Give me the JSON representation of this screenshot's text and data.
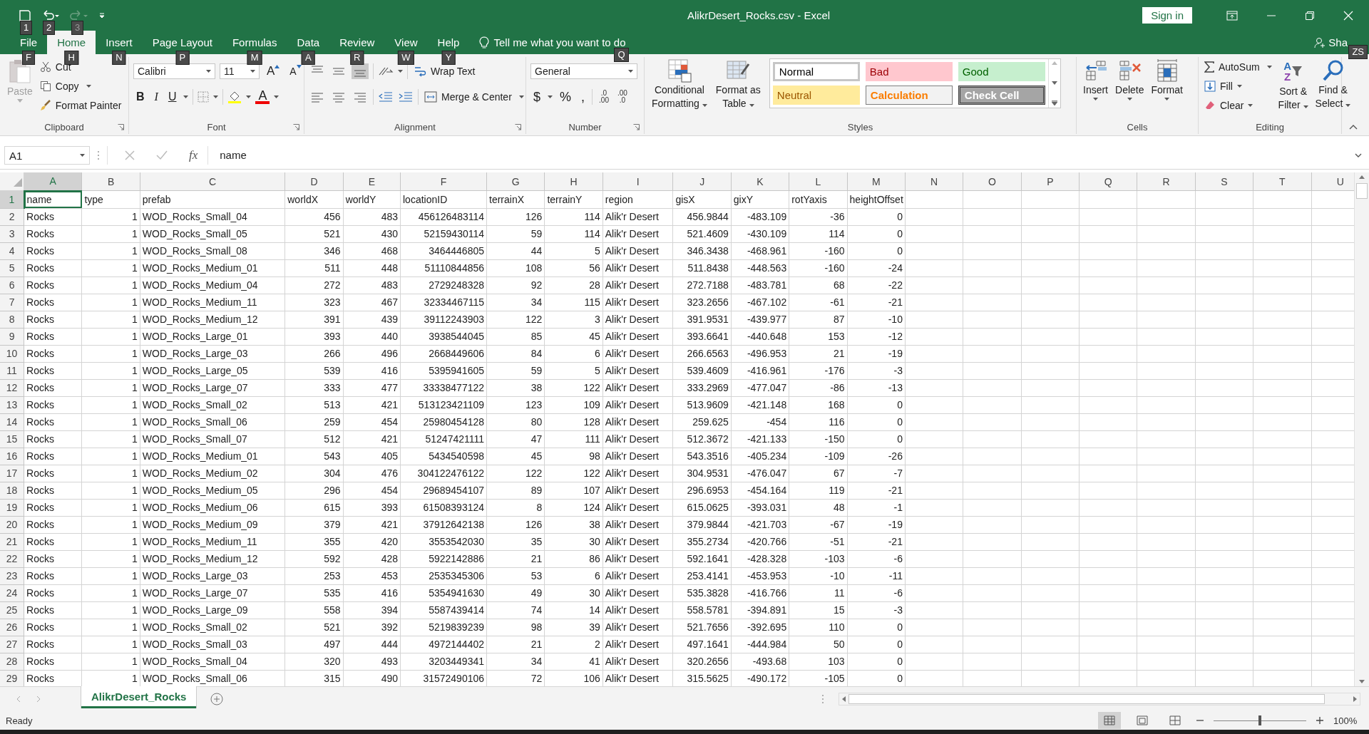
{
  "title_bar": {
    "title": "AlikrDesert_Rocks.csv  -  Excel",
    "sign_in": "Sign in",
    "quick_access_keytips": [
      "1",
      "2",
      "3"
    ]
  },
  "menu_tabs": [
    {
      "label": "File",
      "keytip": "F",
      "selected": false
    },
    {
      "label": "Home",
      "keytip": "H",
      "selected": true
    },
    {
      "label": "Insert",
      "keytip": "N",
      "selected": false
    },
    {
      "label": "Page Layout",
      "keytip": "P",
      "selected": false
    },
    {
      "label": "Formulas",
      "keytip": "M",
      "selected": false
    },
    {
      "label": "Data",
      "keytip": "A",
      "selected": false
    },
    {
      "label": "Review",
      "keytip": "R",
      "selected": false
    },
    {
      "label": "View",
      "keytip": "W",
      "selected": false
    },
    {
      "label": "Help",
      "keytip": "Y",
      "selected": false
    }
  ],
  "tell_me": {
    "placeholder": "Tell me what you want to do",
    "keytip": "Q"
  },
  "share": {
    "label": "Sha",
    "keytip": "ZS"
  },
  "ribbon": {
    "clipboard": {
      "label": "Clipboard",
      "paste": {
        "label": "Paste",
        "disabled": true
      },
      "cut": "Cut",
      "copy": "Copy",
      "format_painter": "Format Painter"
    },
    "font": {
      "label": "Font",
      "font_name": "Calibri",
      "font_size": "11",
      "grow": "A",
      "shrink": "A",
      "bold": "B",
      "italic": "I",
      "underline": "U",
      "font_color": "A"
    },
    "alignment": {
      "label": "Alignment",
      "wrap_text": "Wrap Text",
      "merge": "Merge & Center"
    },
    "number": {
      "label": "Number",
      "format": "General",
      "currency": "$",
      "percent": "%",
      "comma": ",",
      "decimals": [
        {
          "top": ".0",
          "bottom": ".00"
        },
        {
          "top": ".00",
          "bottom": ".0"
        }
      ]
    },
    "styles": {
      "label": "Styles",
      "conditional": [
        "Conditional",
        "Formatting"
      ],
      "format_table": [
        "Format as",
        "Table"
      ],
      "gallery": [
        {
          "label": "Normal",
          "kind": "normal",
          "selected": true
        },
        {
          "label": "Bad",
          "kind": "bad",
          "selected": false
        },
        {
          "label": "Good",
          "kind": "good",
          "selected": false
        },
        {
          "label": "Neutral",
          "kind": "neutral",
          "selected": false
        },
        {
          "label": "Calculation",
          "kind": "calculation",
          "selected": false
        },
        {
          "label": "Check Cell",
          "kind": "check",
          "selected": false
        }
      ]
    },
    "cells": {
      "label": "Cells",
      "buttons": [
        {
          "label": "Insert",
          "kind": "insert"
        },
        {
          "label": "Delete",
          "kind": "delete"
        },
        {
          "label": "Format",
          "kind": "format"
        }
      ]
    },
    "editing": {
      "label": "Editing",
      "autosum": "AutoSum",
      "fill": "Fill",
      "clear": "Clear",
      "sort": [
        "Sort &",
        "Filter"
      ],
      "sort_letters": [
        "A",
        "Z"
      ],
      "find": [
        "Find &",
        "Select"
      ]
    }
  },
  "formula_bar": {
    "name_box": "A1",
    "fx": "fx",
    "value": "name"
  },
  "columns": [
    {
      "letter": "A",
      "kind": "text",
      "selected": true
    },
    {
      "letter": "B",
      "kind": "number",
      "selected": false
    },
    {
      "letter": "C",
      "kind": "text",
      "selected": false
    },
    {
      "letter": "D",
      "kind": "number",
      "selected": false
    },
    {
      "letter": "E",
      "kind": "number",
      "selected": false
    },
    {
      "letter": "F",
      "kind": "number",
      "selected": false
    },
    {
      "letter": "G",
      "kind": "number",
      "selected": false
    },
    {
      "letter": "H",
      "kind": "number",
      "selected": false
    },
    {
      "letter": "I",
      "kind": "text",
      "selected": false
    },
    {
      "letter": "J",
      "kind": "number",
      "selected": false
    },
    {
      "letter": "K",
      "kind": "number",
      "selected": false
    },
    {
      "letter": "L",
      "kind": "number",
      "selected": false
    },
    {
      "letter": "M",
      "kind": "number",
      "selected": false
    },
    {
      "letter": "N",
      "selected": false
    },
    {
      "letter": "O",
      "selected": false
    },
    {
      "letter": "P",
      "selected": false
    },
    {
      "letter": "Q",
      "selected": false
    },
    {
      "letter": "R",
      "selected": false
    },
    {
      "letter": "S",
      "selected": false
    },
    {
      "letter": "T",
      "selected": false
    },
    {
      "letter": "U",
      "selected": false
    }
  ],
  "rows": [
    {
      "number": "1",
      "selected": true,
      "kind": "heading",
      "cells": [
        "name",
        "type",
        "prefab",
        "worldX",
        "worldY",
        "locationID",
        "terrainX",
        "terrainY",
        "region",
        "gisX",
        "gixY",
        "rotYaxis",
        "heightOffset"
      ]
    },
    {
      "number": "2",
      "selected": false,
      "cells": [
        "Rocks",
        "1",
        "WOD_Rocks_Small_04",
        "456",
        "483",
        "456126483114",
        "126",
        "114",
        "Alik'r Desert",
        "456.9844",
        "-483.109",
        "-36",
        "0"
      ]
    },
    {
      "number": "3",
      "selected": false,
      "cells": [
        "Rocks",
        "1",
        "WOD_Rocks_Small_05",
        "521",
        "430",
        "52159430114",
        "59",
        "114",
        "Alik'r Desert",
        "521.4609",
        "-430.109",
        "114",
        "0"
      ]
    },
    {
      "number": "4",
      "selected": false,
      "cells": [
        "Rocks",
        "1",
        "WOD_Rocks_Small_08",
        "346",
        "468",
        "3464446805",
        "44",
        "5",
        "Alik'r Desert",
        "346.3438",
        "-468.961",
        "-160",
        "0"
      ]
    },
    {
      "number": "5",
      "selected": false,
      "cells": [
        "Rocks",
        "1",
        "WOD_Rocks_Medium_01",
        "511",
        "448",
        "51110844856",
        "108",
        "56",
        "Alik'r Desert",
        "511.8438",
        "-448.563",
        "-160",
        "-24"
      ]
    },
    {
      "number": "6",
      "selected": false,
      "cells": [
        "Rocks",
        "1",
        "WOD_Rocks_Medium_04",
        "272",
        "483",
        "2729248328",
        "92",
        "28",
        "Alik'r Desert",
        "272.7188",
        "-483.781",
        "68",
        "-22"
      ]
    },
    {
      "number": "7",
      "selected": false,
      "cells": [
        "Rocks",
        "1",
        "WOD_Rocks_Medium_11",
        "323",
        "467",
        "32334467115",
        "34",
        "115",
        "Alik'r Desert",
        "323.2656",
        "-467.102",
        "-61",
        "-21"
      ]
    },
    {
      "number": "8",
      "selected": false,
      "cells": [
        "Rocks",
        "1",
        "WOD_Rocks_Medium_12",
        "391",
        "439",
        "39112243903",
        "122",
        "3",
        "Alik'r Desert",
        "391.9531",
        "-439.977",
        "87",
        "-10"
      ]
    },
    {
      "number": "9",
      "selected": false,
      "cells": [
        "Rocks",
        "1",
        "WOD_Rocks_Large_01",
        "393",
        "440",
        "3938544045",
        "85",
        "45",
        "Alik'r Desert",
        "393.6641",
        "-440.648",
        "153",
        "-12"
      ]
    },
    {
      "number": "10",
      "selected": false,
      "cells": [
        "Rocks",
        "1",
        "WOD_Rocks_Large_03",
        "266",
        "496",
        "2668449606",
        "84",
        "6",
        "Alik'r Desert",
        "266.6563",
        "-496.953",
        "21",
        "-19"
      ]
    },
    {
      "number": "11",
      "selected": false,
      "cells": [
        "Rocks",
        "1",
        "WOD_Rocks_Large_05",
        "539",
        "416",
        "5395941605",
        "59",
        "5",
        "Alik'r Desert",
        "539.4609",
        "-416.961",
        "-176",
        "-3"
      ]
    },
    {
      "number": "12",
      "selected": false,
      "cells": [
        "Rocks",
        "1",
        "WOD_Rocks_Large_07",
        "333",
        "477",
        "33338477122",
        "38",
        "122",
        "Alik'r Desert",
        "333.2969",
        "-477.047",
        "-86",
        "-13"
      ]
    },
    {
      "number": "13",
      "selected": false,
      "cells": [
        "Rocks",
        "1",
        "WOD_Rocks_Small_02",
        "513",
        "421",
        "513123421109",
        "123",
        "109",
        "Alik'r Desert",
        "513.9609",
        "-421.148",
        "168",
        "0"
      ]
    },
    {
      "number": "14",
      "selected": false,
      "cells": [
        "Rocks",
        "1",
        "WOD_Rocks_Small_06",
        "259",
        "454",
        "25980454128",
        "80",
        "128",
        "Alik'r Desert",
        "259.625",
        "-454",
        "116",
        "0"
      ]
    },
    {
      "number": "15",
      "selected": false,
      "cells": [
        "Rocks",
        "1",
        "WOD_Rocks_Small_07",
        "512",
        "421",
        "51247421111",
        "47",
        "111",
        "Alik'r Desert",
        "512.3672",
        "-421.133",
        "-150",
        "0"
      ]
    },
    {
      "number": "16",
      "selected": false,
      "cells": [
        "Rocks",
        "1",
        "WOD_Rocks_Medium_01",
        "543",
        "405",
        "5434540598",
        "45",
        "98",
        "Alik'r Desert",
        "543.3516",
        "-405.234",
        "-109",
        "-26"
      ]
    },
    {
      "number": "17",
      "selected": false,
      "cells": [
        "Rocks",
        "1",
        "WOD_Rocks_Medium_02",
        "304",
        "476",
        "304122476122",
        "122",
        "122",
        "Alik'r Desert",
        "304.9531",
        "-476.047",
        "67",
        "-7"
      ]
    },
    {
      "number": "18",
      "selected": false,
      "cells": [
        "Rocks",
        "1",
        "WOD_Rocks_Medium_05",
        "296",
        "454",
        "29689454107",
        "89",
        "107",
        "Alik'r Desert",
        "296.6953",
        "-454.164",
        "119",
        "-21"
      ]
    },
    {
      "number": "19",
      "selected": false,
      "cells": [
        "Rocks",
        "1",
        "WOD_Rocks_Medium_06",
        "615",
        "393",
        "61508393124",
        "8",
        "124",
        "Alik'r Desert",
        "615.0625",
        "-393.031",
        "48",
        "-1"
      ]
    },
    {
      "number": "20",
      "selected": false,
      "cells": [
        "Rocks",
        "1",
        "WOD_Rocks_Medium_09",
        "379",
        "421",
        "37912642138",
        "126",
        "38",
        "Alik'r Desert",
        "379.9844",
        "-421.703",
        "-67",
        "-19"
      ]
    },
    {
      "number": "21",
      "selected": false,
      "cells": [
        "Rocks",
        "1",
        "WOD_Rocks_Medium_11",
        "355",
        "420",
        "3553542030",
        "35",
        "30",
        "Alik'r Desert",
        "355.2734",
        "-420.766",
        "-51",
        "-21"
      ]
    },
    {
      "number": "22",
      "selected": false,
      "cells": [
        "Rocks",
        "1",
        "WOD_Rocks_Medium_12",
        "592",
        "428",
        "5922142886",
        "21",
        "86",
        "Alik'r Desert",
        "592.1641",
        "-428.328",
        "-103",
        "-6"
      ]
    },
    {
      "number": "23",
      "selected": false,
      "cells": [
        "Rocks",
        "1",
        "WOD_Rocks_Large_03",
        "253",
        "453",
        "2535345306",
        "53",
        "6",
        "Alik'r Desert",
        "253.4141",
        "-453.953",
        "-10",
        "-11"
      ]
    },
    {
      "number": "24",
      "selected": false,
      "cells": [
        "Rocks",
        "1",
        "WOD_Rocks_Large_07",
        "535",
        "416",
        "5354941630",
        "49",
        "30",
        "Alik'r Desert",
        "535.3828",
        "-416.766",
        "11",
        "-6"
      ]
    },
    {
      "number": "25",
      "selected": false,
      "cells": [
        "Rocks",
        "1",
        "WOD_Rocks_Large_09",
        "558",
        "394",
        "5587439414",
        "74",
        "14",
        "Alik'r Desert",
        "558.5781",
        "-394.891",
        "15",
        "-3"
      ]
    },
    {
      "number": "26",
      "selected": false,
      "cells": [
        "Rocks",
        "1",
        "WOD_Rocks_Small_02",
        "521",
        "392",
        "5219839239",
        "98",
        "39",
        "Alik'r Desert",
        "521.7656",
        "-392.695",
        "110",
        "0"
      ]
    },
    {
      "number": "27",
      "selected": false,
      "cells": [
        "Rocks",
        "1",
        "WOD_Rocks_Small_03",
        "497",
        "444",
        "4972144402",
        "21",
        "2",
        "Alik'r Desert",
        "497.1641",
        "-444.984",
        "50",
        "0"
      ]
    },
    {
      "number": "28",
      "selected": false,
      "cells": [
        "Rocks",
        "1",
        "WOD_Rocks_Small_04",
        "320",
        "493",
        "3203449341",
        "34",
        "41",
        "Alik'r Desert",
        "320.2656",
        "-493.68",
        "103",
        "0"
      ]
    },
    {
      "number": "29",
      "selected": false,
      "cells": [
        "Rocks",
        "1",
        "WOD_Rocks_Small_06",
        "315",
        "490",
        "31572490106",
        "72",
        "106",
        "Alik'r Desert",
        "315.5625",
        "-490.172",
        "-105",
        "0"
      ]
    }
  ],
  "sheet_tabs": [
    {
      "label": "AlikrDesert_Rocks",
      "selected": true
    }
  ],
  "status_bar": {
    "status": "Ready",
    "views": [
      {
        "kind": "normal",
        "selected": true
      },
      {
        "kind": "page_layout",
        "selected": false
      },
      {
        "kind": "page_break",
        "selected": false
      }
    ],
    "zoom": {
      "level": 0.5,
      "reading": "100%"
    }
  }
}
